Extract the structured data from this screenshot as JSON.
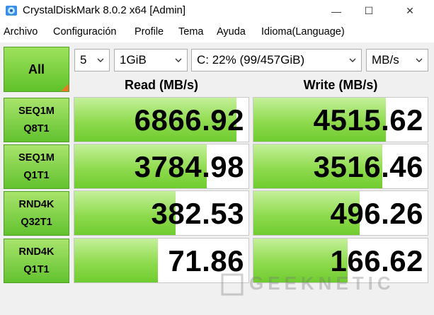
{
  "window": {
    "title": "CrystalDiskMark 8.0.2 x64 [Admin]",
    "minimize_glyph": "—",
    "maximize_glyph": "☐",
    "close_glyph": "✕"
  },
  "menu": {
    "items": [
      "Archivo",
      "Configuración",
      "Profile",
      "Tema",
      "Ayuda",
      "Idioma(Language)"
    ]
  },
  "controls": {
    "all_button": "All",
    "count": "5",
    "size": "1GiB",
    "drive": "C: 22% (99/457GiB)",
    "unit": "MB/s"
  },
  "columns": {
    "read": "Read (MB/s)",
    "write": "Write (MB/s)"
  },
  "tests": [
    {
      "line1": "SEQ1M",
      "line2": "Q8T1",
      "read": "6866.92",
      "write": "4515.62",
      "read_fill": 0.93,
      "write_fill": 0.76
    },
    {
      "line1": "SEQ1M",
      "line2": "Q1T1",
      "read": "3784.98",
      "write": "3516.46",
      "read_fill": 0.76,
      "write_fill": 0.74
    },
    {
      "line1": "RND4K",
      "line2": "Q32T1",
      "read": "382.53",
      "write": "496.26",
      "read_fill": 0.58,
      "write_fill": 0.61
    },
    {
      "line1": "RND4K",
      "line2": "Q1T1",
      "read": "71.86",
      "write": "166.62",
      "read_fill": 0.48,
      "write_fill": 0.54
    }
  ],
  "watermark": "GEEKNETIC",
  "colors": {
    "accent_green": "#6fcc2f",
    "orange_corner": "#e8792b"
  }
}
